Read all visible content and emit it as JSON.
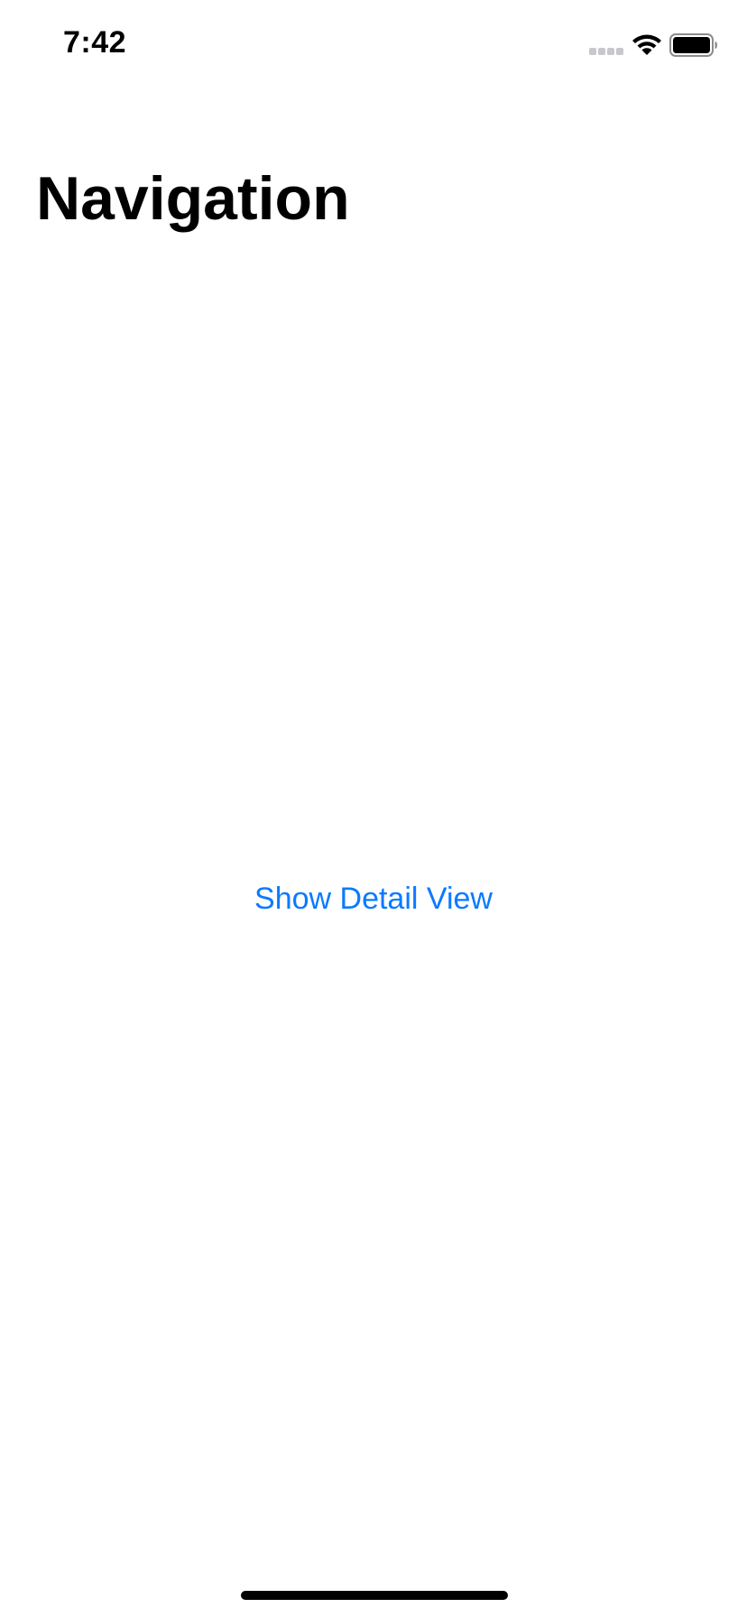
{
  "status_bar": {
    "time": "7:42",
    "icons": [
      "signal-icon",
      "wifi-icon",
      "battery-icon"
    ]
  },
  "navigation": {
    "title": "Navigation"
  },
  "content": {
    "link_label": "Show Detail View"
  },
  "colors": {
    "accent": "#0a7aff",
    "background": "#ffffff",
    "text": "#000000"
  }
}
